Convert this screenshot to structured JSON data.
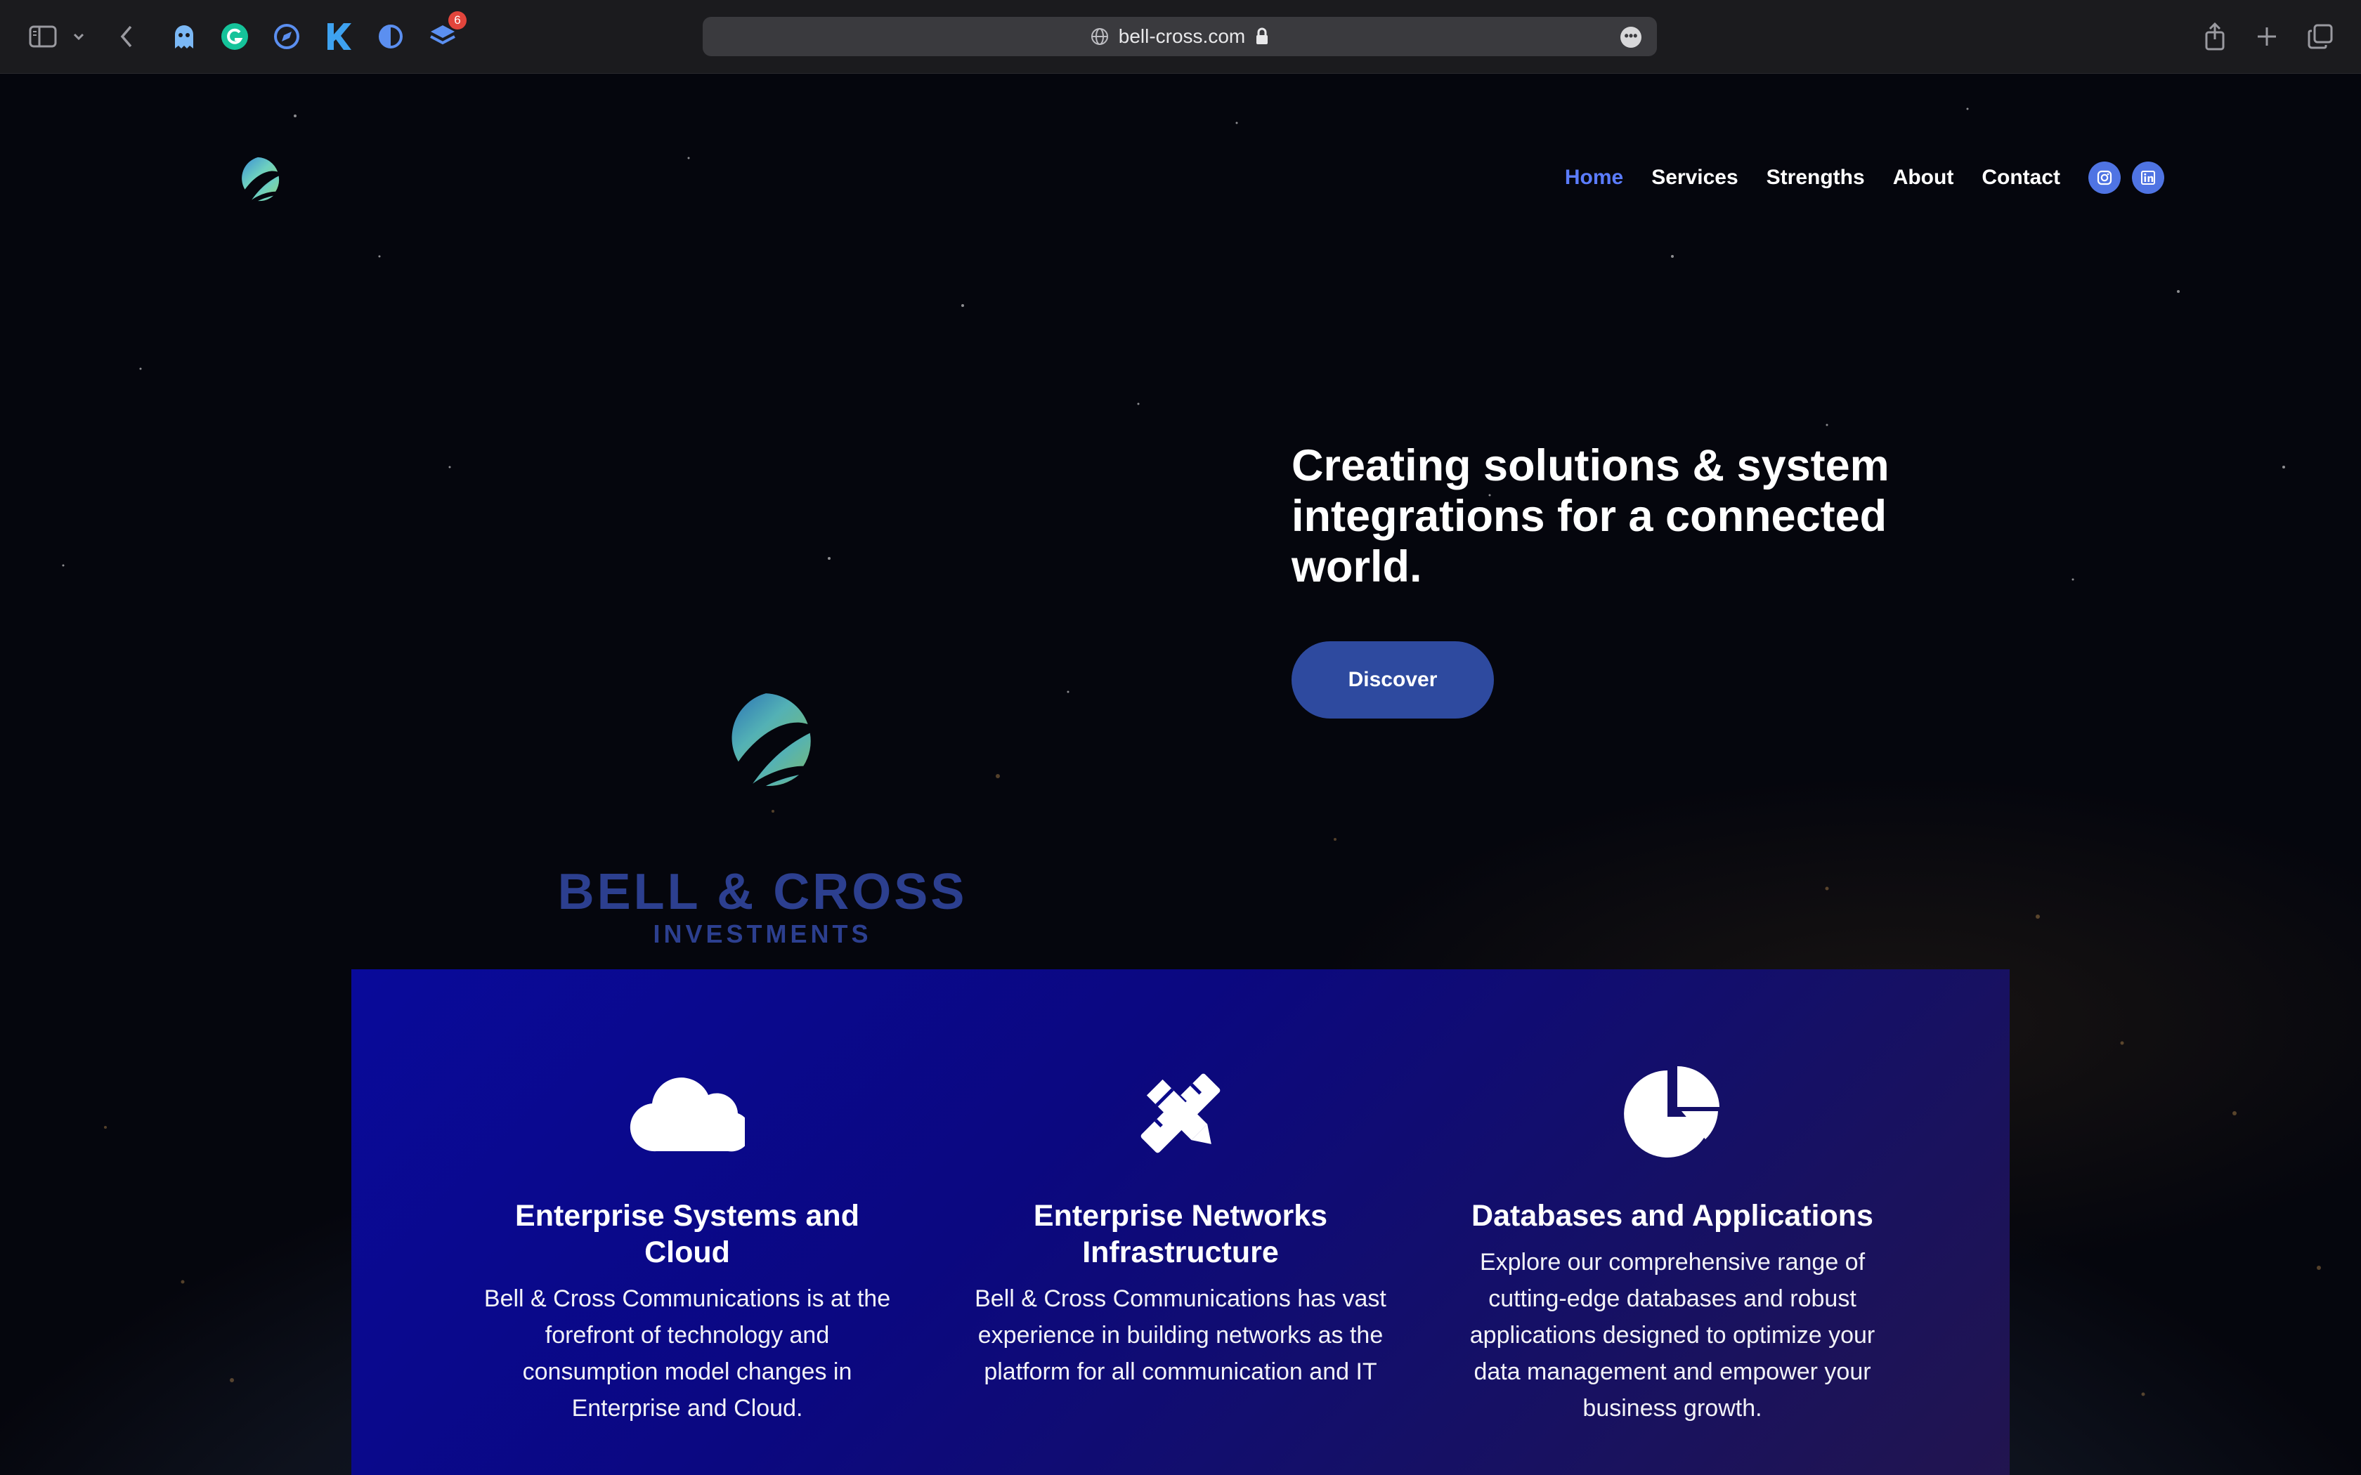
{
  "browser": {
    "url": "bell-cross.com",
    "extensions_badge": "6",
    "extensions": [
      "ghost-extension-icon",
      "grammarly-icon",
      "compass-extension-icon",
      "k-extension-icon",
      "dark-mode-extension-icon",
      "layers-extension-icon"
    ]
  },
  "nav": {
    "items": [
      {
        "label": "Home",
        "active": true
      },
      {
        "label": "Services",
        "active": false
      },
      {
        "label": "Strengths",
        "active": false
      },
      {
        "label": "About",
        "active": false
      },
      {
        "label": "Contact",
        "active": false
      }
    ],
    "social": [
      "instagram-icon",
      "linkedin-icon"
    ]
  },
  "hero": {
    "headline": "Creating solutions & system integrations for a connected world.",
    "cta_label": "Discover",
    "brand_name": "BELL & CROSS",
    "brand_sub": "INVESTMENTS"
  },
  "features": [
    {
      "icon": "cloud-icon",
      "title": "Enterprise Systems and Cloud",
      "text": "Bell & Cross Communications is at the forefront of technology and consumption model changes in Enterprise and Cloud."
    },
    {
      "icon": "pencil-ruler-icon",
      "title": "Enterprise Networks Infrastructure",
      "text": "Bell & Cross Communications has vast experience in building networks as the platform for all communication and IT"
    },
    {
      "icon": "pie-chart-icon",
      "title": "Databases and Applications",
      "text": "Explore our comprehensive range of cutting-edge databases and robust applications designed to optimize your data management and empower your business growth."
    }
  ],
  "colors": {
    "accent": "#5b7cff",
    "cta": "#2e4a9f",
    "features_bg": "#0a0a95"
  }
}
